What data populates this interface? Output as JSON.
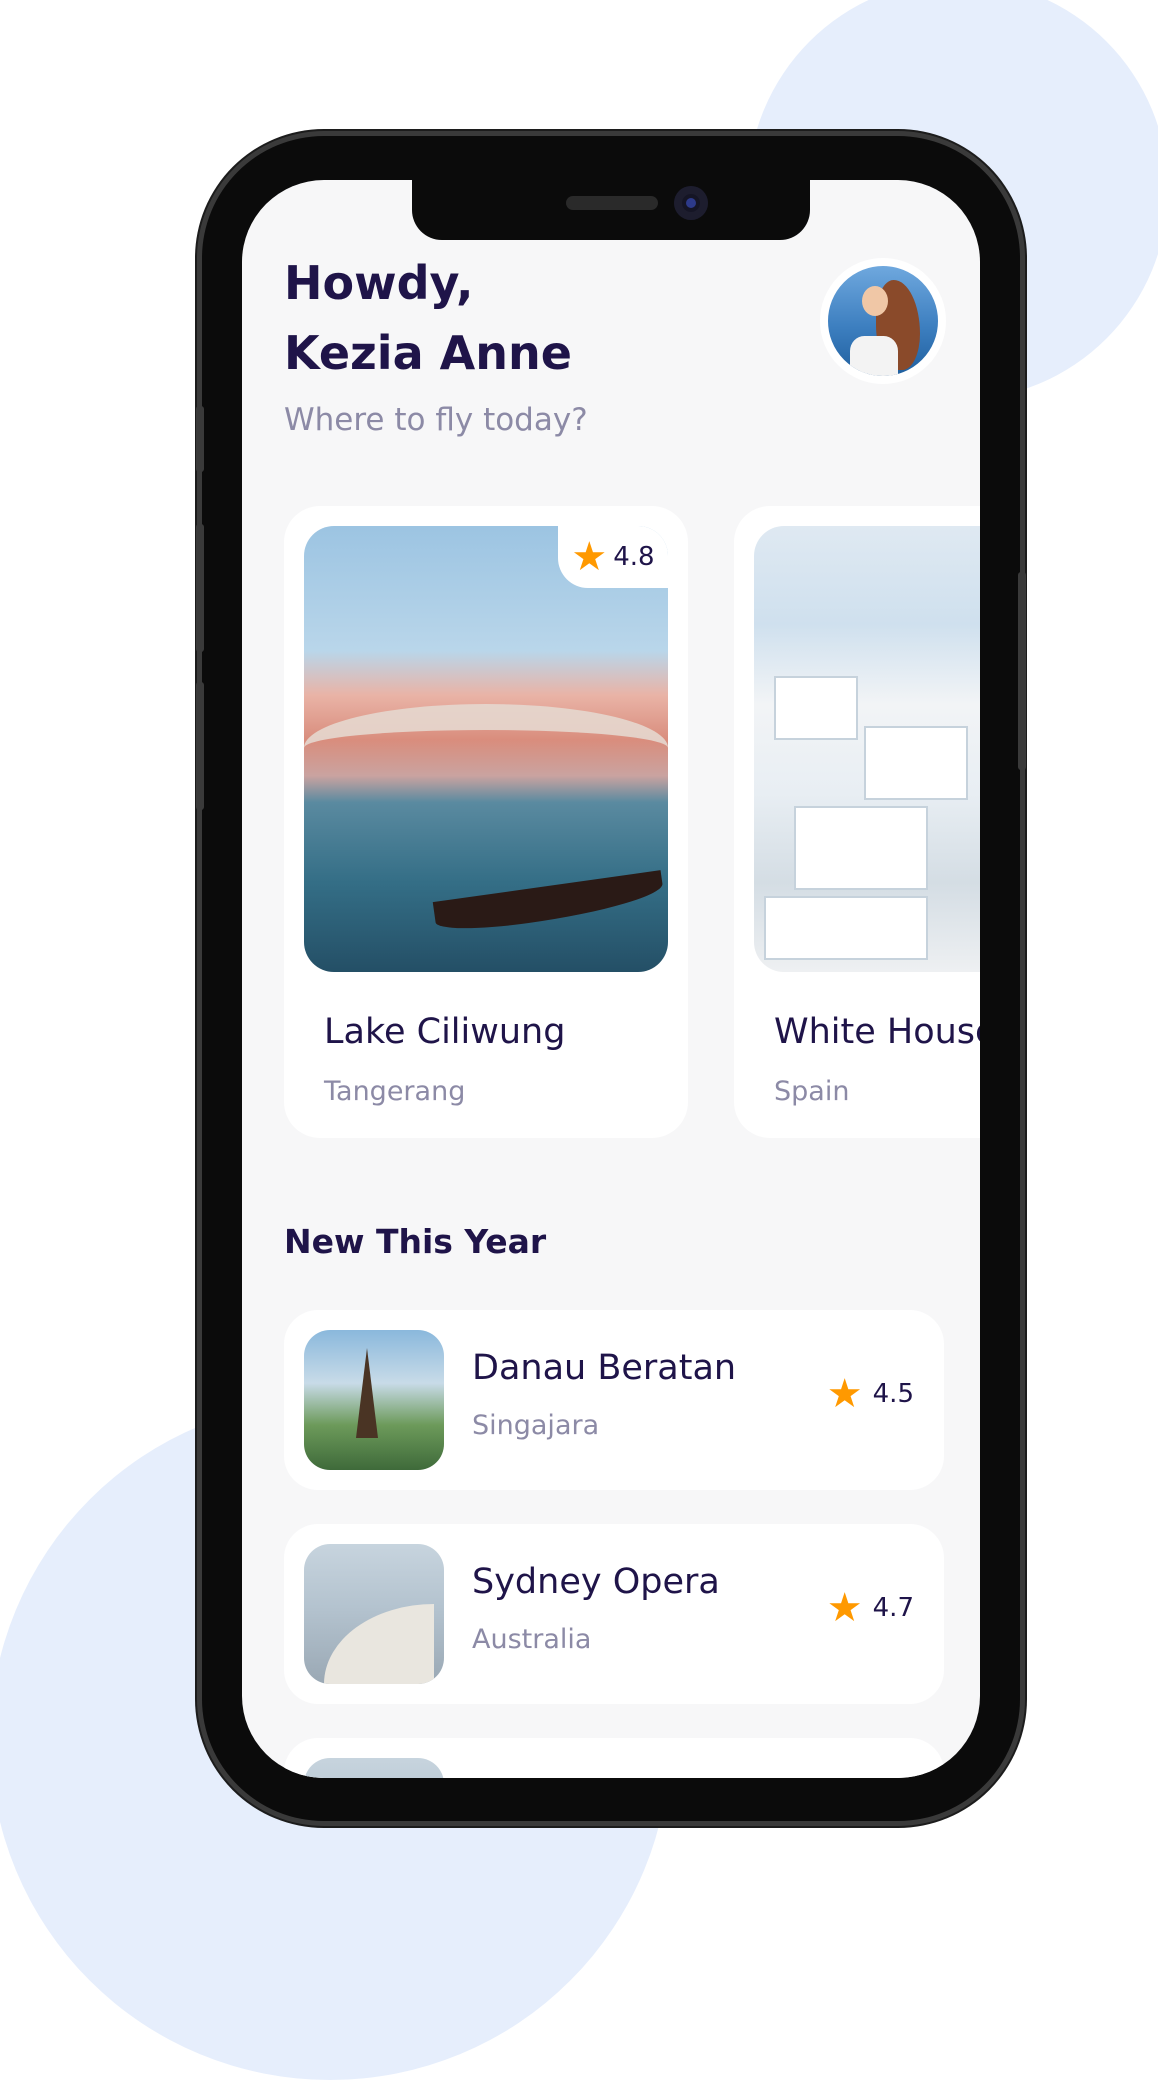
{
  "greeting": {
    "line1": "Howdy,",
    "line2": "Kezia Anne",
    "subtitle": "Where to fly today?"
  },
  "featured": [
    {
      "title": "Lake Ciliwung",
      "location": "Tangerang",
      "rating": "4.8"
    },
    {
      "title": "White House",
      "location": "Spain"
    }
  ],
  "new_this_year": {
    "title": "New This Year",
    "items": [
      {
        "name": "Danau Beratan",
        "location": "Singajara",
        "rating": "4.5"
      },
      {
        "name": "Sydney Opera",
        "location": "Australia",
        "rating": "4.7"
      }
    ]
  },
  "icons": {
    "star": "star-icon",
    "avatar": "user-avatar"
  },
  "colors": {
    "primary_text": "#1F1449",
    "muted_text": "#8C8AA6",
    "star": "#FF9900",
    "background_circles": "#E6EEFC"
  }
}
